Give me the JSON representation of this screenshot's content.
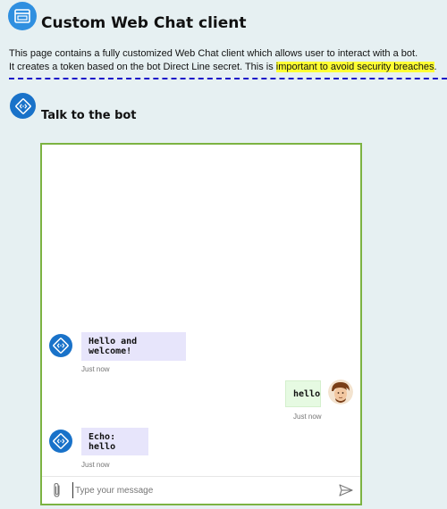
{
  "header": {
    "title": "Custom Web Chat client",
    "icon": "browser-window-icon",
    "description_line1": "This page contains a fully customized Web Chat client which allows user to interact with a bot.",
    "description_line2_prefix": "It creates a token based on the bot Direct Line secret. This is ",
    "description_line2_highlight": "important to avoid security breaches",
    "description_line2_suffix": "."
  },
  "section": {
    "title": "Talk to the bot",
    "icon": "bot-code-icon"
  },
  "chat": {
    "border_color": "#7cb342",
    "messages": [
      {
        "from": "bot",
        "text": "Hello and welcome!",
        "timestamp": "Just now"
      },
      {
        "from": "user",
        "text": "hello",
        "timestamp": "Just now"
      },
      {
        "from": "bot",
        "text": "Echo: hello",
        "timestamp": "Just now"
      }
    ],
    "sendbox": {
      "placeholder": "Type your message",
      "value": "",
      "attach_icon": "paperclip-icon",
      "send_icon": "send-icon"
    }
  },
  "colors": {
    "page_background": "#e6f0f2",
    "bot_bubble": "#e7e5fb",
    "user_bubble": "#e6fae2",
    "highlight": "#ffff33",
    "divider": "#1b14c9",
    "bot_avatar": "#1972c9"
  }
}
